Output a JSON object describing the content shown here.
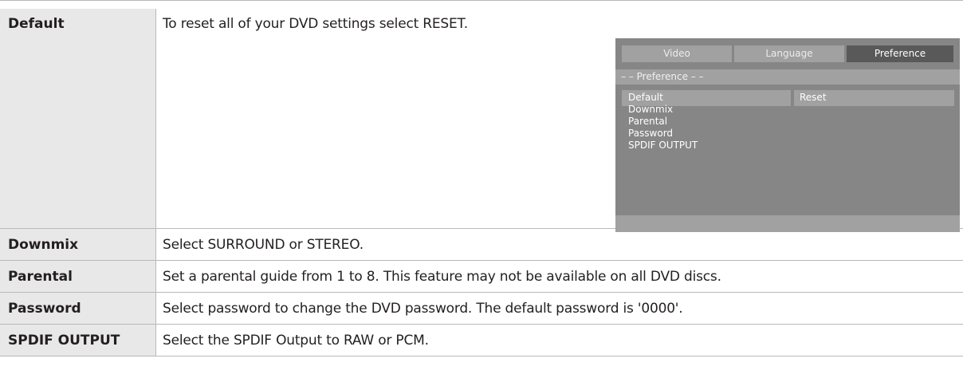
{
  "rows": [
    {
      "label": "Default",
      "description": "To reset all of your DVD settings select RESET."
    },
    {
      "label": "Downmix",
      "description": "Select SURROUND or STEREO."
    },
    {
      "label": "Parental",
      "description": "Set a parental guide from 1 to 8. This feature may not be available on all DVD discs."
    },
    {
      "label": "Password",
      "description": "Select password to change the DVD password. The default password is '0000'."
    },
    {
      "label": "SPDIF OUTPUT",
      "description": "Select the SPDIF Output to RAW or PCM."
    }
  ],
  "osd": {
    "tabs": [
      "Video",
      "Language",
      "Preference"
    ],
    "active_tab": "Preference",
    "section_title": "– – Preference – –",
    "items": [
      "Default",
      "Downmix",
      "Parental",
      "Password",
      "SPDIF OUTPUT"
    ],
    "selected_value": "Reset"
  },
  "colors": {
    "label_bg": "#e8e8e8",
    "rule": "#b9b9b9",
    "osd_bg": "#868686",
    "osd_bar": "#a1a1a1",
    "osd_active_tab": "#595959"
  }
}
